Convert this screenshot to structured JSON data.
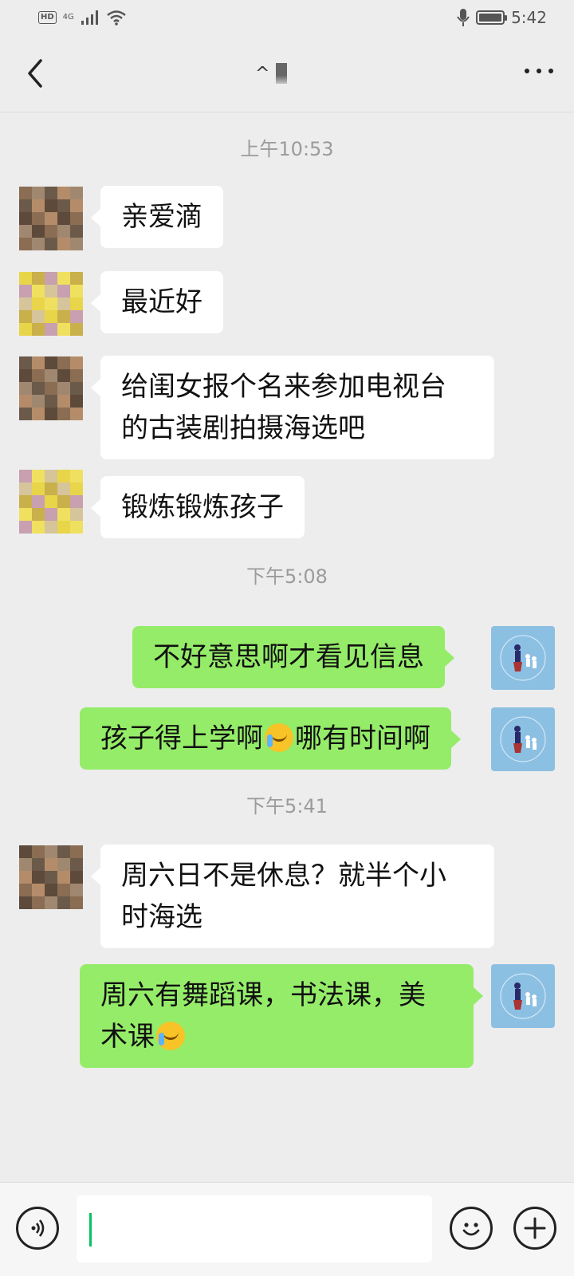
{
  "status_bar": {
    "hd": "HD",
    "network": "4G",
    "time": "5:42"
  },
  "header": {
    "title": "^",
    "back_icon": "chevron-left-icon",
    "more_icon": "more-horizontal-icon"
  },
  "timestamps": [
    "上午10:53",
    "下午5:08",
    "下午5:41"
  ],
  "messages": [
    {
      "side": "in",
      "text": "亲爱滴"
    },
    {
      "side": "in",
      "text": "最近好"
    },
    {
      "side": "in",
      "line1": "给闺女报个名来参加电视台",
      "line2": "的古装剧拍摄海选吧"
    },
    {
      "side": "in",
      "text": "锻炼锻炼孩子"
    },
    {
      "side": "out",
      "text": "不好意思啊才看见信息"
    },
    {
      "side": "out",
      "before": "孩子得上学啊",
      "after": "哪有时间啊"
    },
    {
      "side": "in",
      "line1": "周六日不是休息？就半个小",
      "line2": "时海选"
    },
    {
      "side": "out",
      "line1": "周六有舞蹈课，书法课，美",
      "line2": "术课"
    }
  ],
  "input_bar": {
    "voice_icon": "voice-icon",
    "emoji_icon": "emoji-icon",
    "plus_icon": "plus-icon"
  },
  "colors": {
    "background": "#ededed",
    "incoming_bubble": "#ffffff",
    "outgoing_bubble": "#95ec69",
    "timestamp": "#9b9b9b",
    "cursor": "#07c160"
  }
}
